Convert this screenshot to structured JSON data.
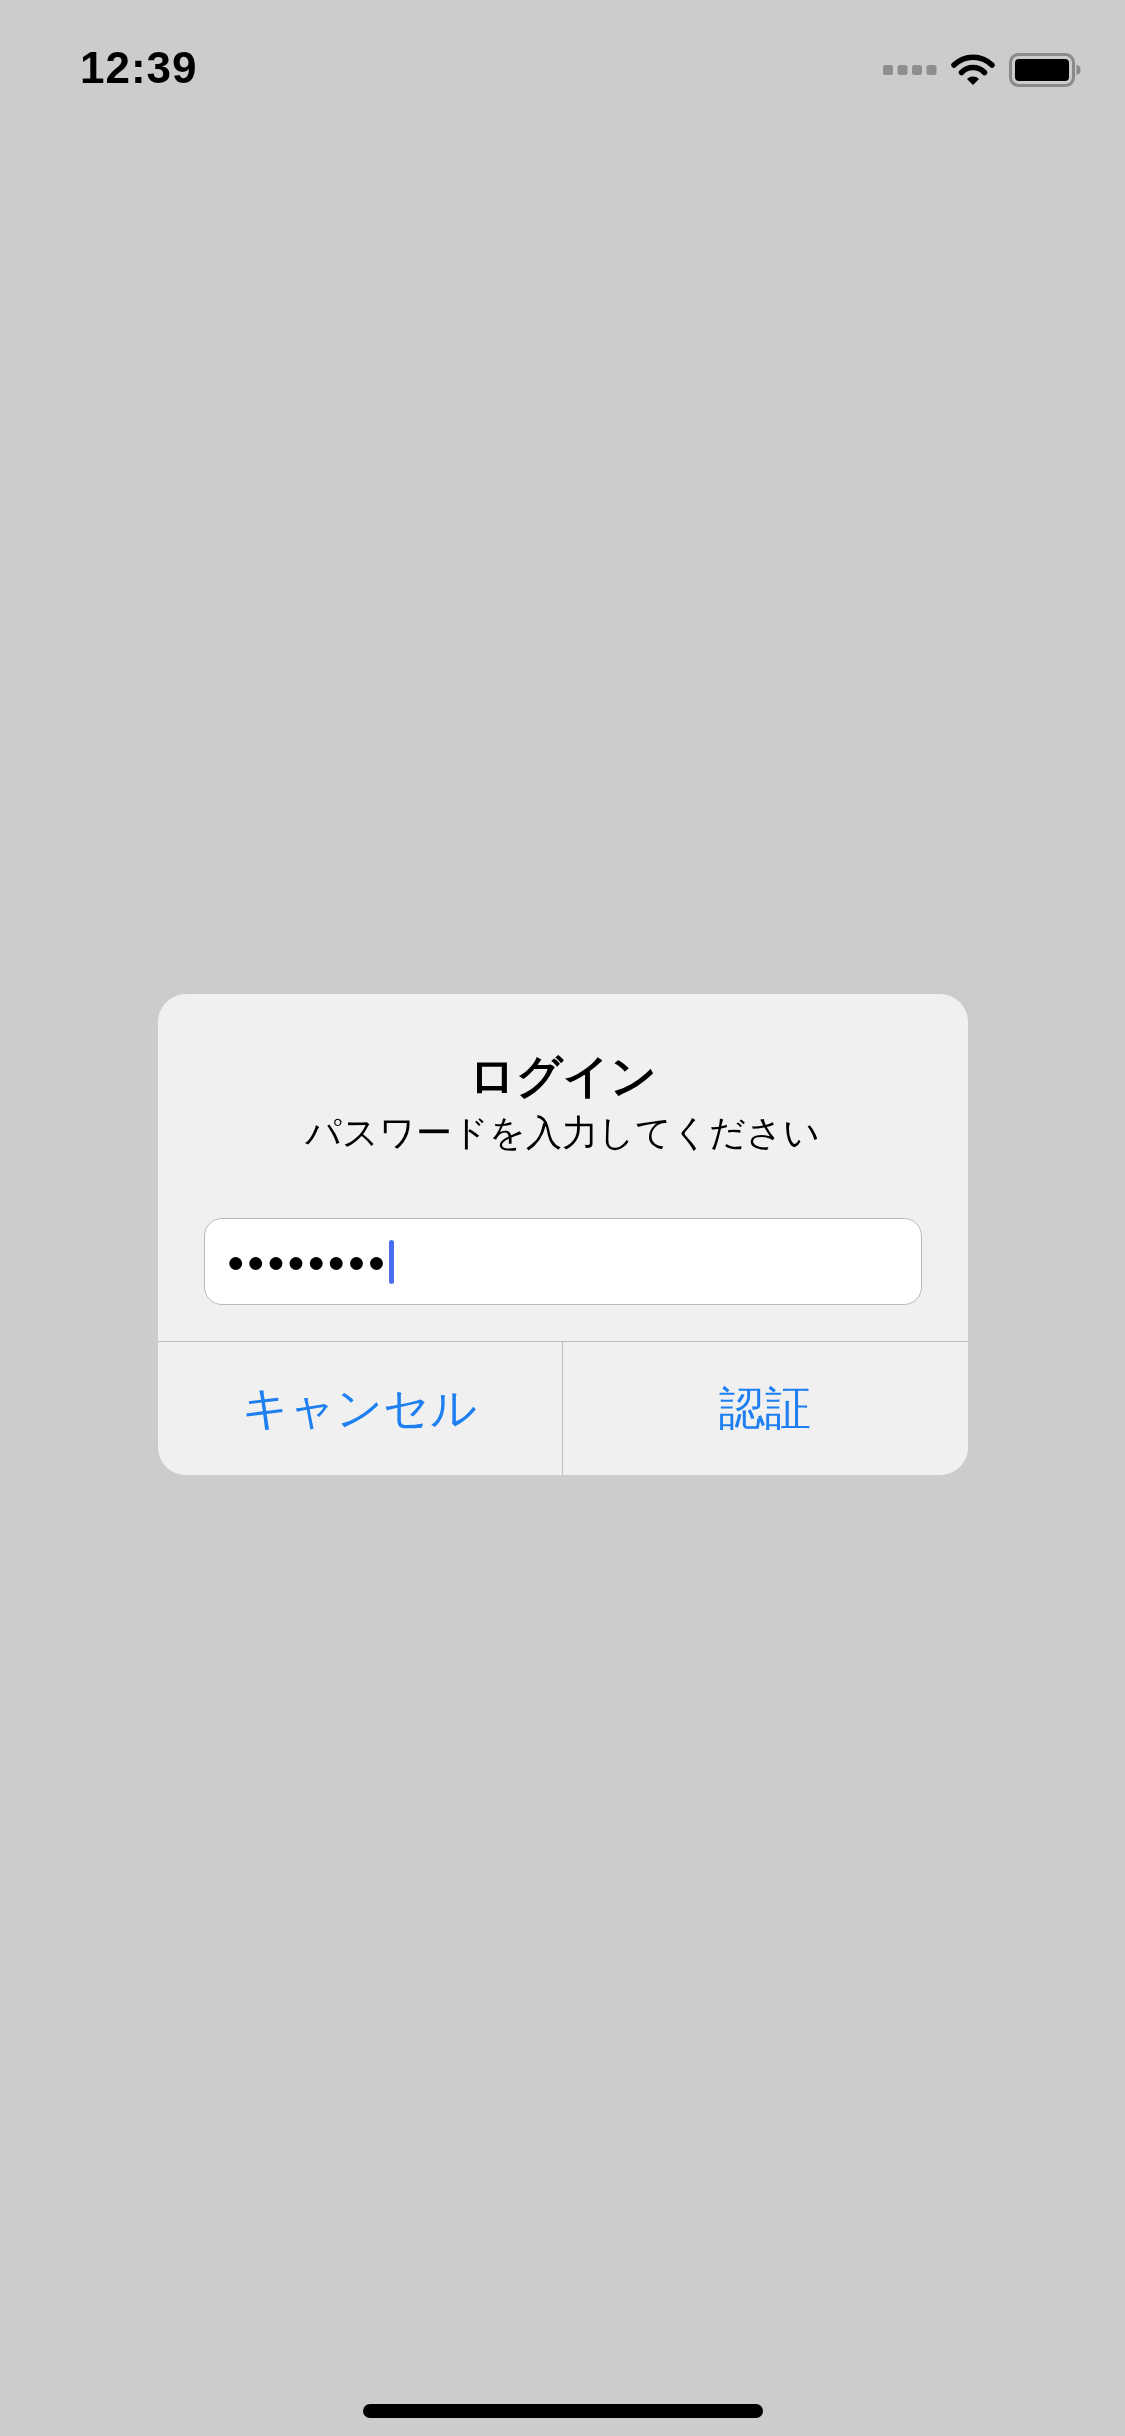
{
  "status_bar": {
    "time": "12:39"
  },
  "dialog": {
    "title": "ログイン",
    "message": "パスワードを入力してください",
    "field": {
      "value": "●●●●●●●●",
      "focused": true
    },
    "buttons": [
      {
        "label": "キャンセル"
      },
      {
        "label": "認証"
      }
    ]
  }
}
